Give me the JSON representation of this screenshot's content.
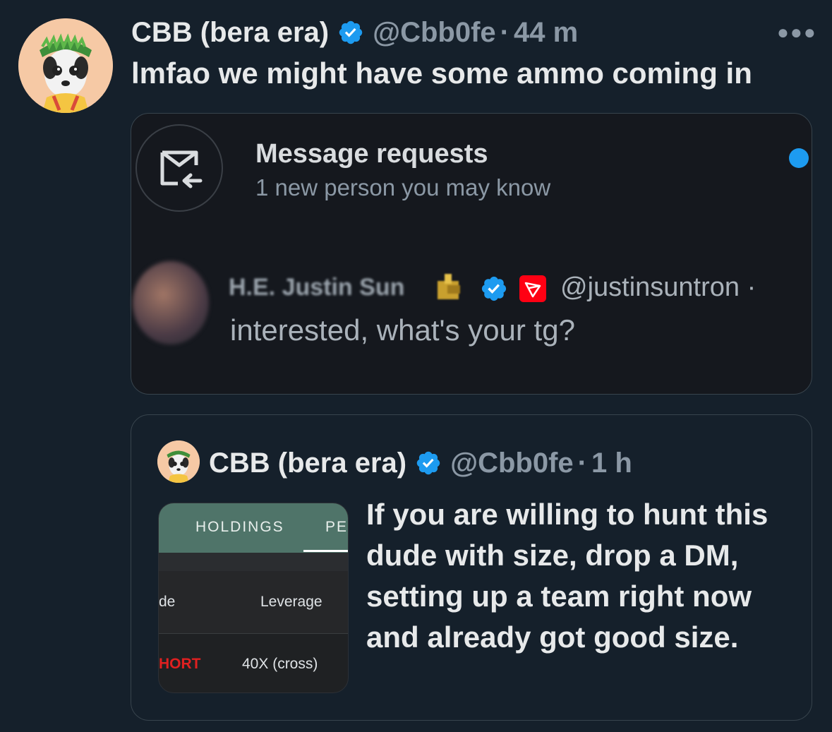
{
  "tweet": {
    "author_name": "CBB (bera era)",
    "handle": "@Cbb0fe",
    "separator": "·",
    "time": "44 m",
    "text": "lmfao we might have some ammo coming in",
    "more_icon": "more-horizontal-icon",
    "verified_color": "#1d9bf0"
  },
  "screenshot_card": {
    "title": "Message requests",
    "subtitle": "1 new person you may know",
    "unread_dot_color": "#1d9bf0",
    "icon": "envelope-arrow-icon",
    "sender_name": "H.E. Justin Sun",
    "sender_handle": "@justinsuntron ·",
    "message": "interested, what's your tg?",
    "tron_color": "#ff0013"
  },
  "quoted_tweet": {
    "author_name": "CBB (bera era)",
    "handle": "@Cbb0fe",
    "separator": "·",
    "time": "1 h",
    "text": "If you are willing to hunt this dude with size, drop a DM, setting up a team right now and already got good size.",
    "image": {
      "tab_holdings": "HOLDINGS",
      "tab_partial": "PE",
      "col_side_partial": "de",
      "col_leverage": "Leverage",
      "side_value_partial": "HORT",
      "leverage_value": "40X (cross)",
      "header_color": "#4f7469",
      "short_color": "#e02020"
    }
  }
}
